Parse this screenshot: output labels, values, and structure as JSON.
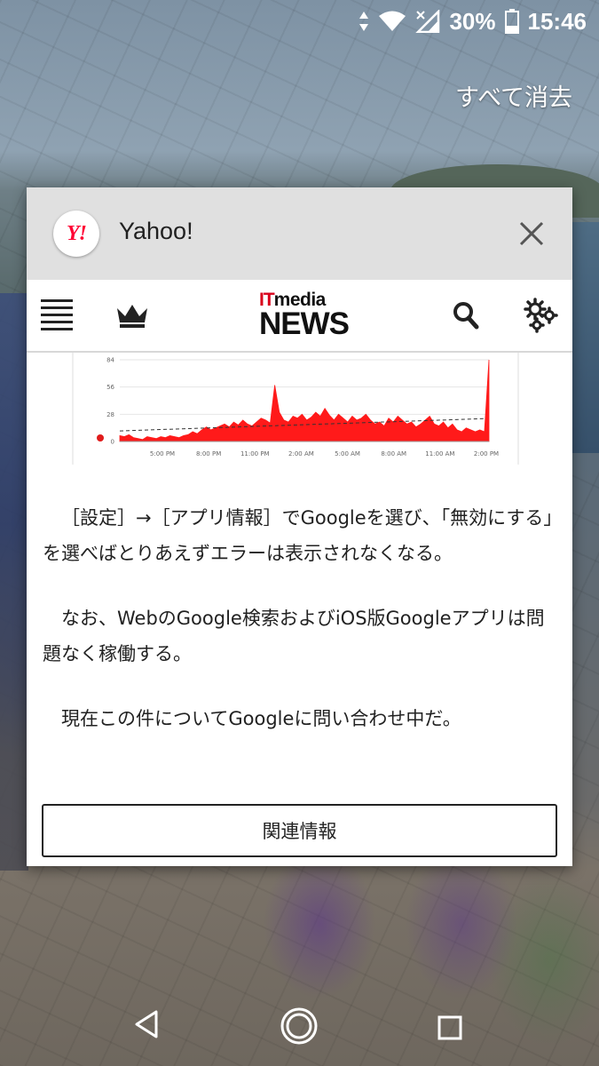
{
  "status_bar": {
    "battery_percent": "30%",
    "time": "15:46",
    "icons": [
      "data-transfer-icon",
      "wifi-icon",
      "cell-signal-no-service-icon",
      "battery-icon"
    ]
  },
  "recents": {
    "clear_all_label": "すべて消去"
  },
  "card": {
    "app_icon_text": "Y!",
    "app_name": "Yahoo!"
  },
  "site": {
    "logo_it": "IT",
    "logo_media": "media",
    "logo_news": "NEWS",
    "toolbar_icons": [
      "menu-icon",
      "crown-icon",
      "search-icon",
      "gear-icon"
    ]
  },
  "chart_data": {
    "type": "area",
    "title": "",
    "xlabel": "",
    "ylabel": "",
    "ylim": [
      0,
      84
    ],
    "y_ticks": [
      "0",
      "28",
      "56",
      "84"
    ],
    "x_ticks": [
      "5:00 PM",
      "8:00 PM",
      "11:00 PM",
      "2:00 AM",
      "5:00 AM",
      "8:00 AM",
      "11:00 AM",
      "2:00 PM"
    ],
    "series": [
      {
        "color": "#ff1a1a",
        "values": [
          6,
          5,
          7,
          4,
          3,
          2,
          5,
          4,
          3,
          5,
          4,
          6,
          5,
          4,
          6,
          7,
          10,
          8,
          12,
          15,
          12,
          14,
          16,
          18,
          15,
          20,
          17,
          22,
          18,
          16,
          20,
          24,
          22,
          19,
          58,
          30,
          22,
          20,
          26,
          24,
          28,
          22,
          25,
          30,
          26,
          34,
          27,
          22,
          28,
          24,
          20,
          26,
          22,
          24,
          28,
          22,
          18,
          20,
          16,
          24,
          20,
          26,
          22,
          18,
          20,
          15,
          18,
          22,
          26,
          18,
          16,
          20,
          14,
          18,
          12,
          10,
          14,
          12,
          10,
          12,
          10,
          84
        ]
      }
    ],
    "trend_line": true,
    "grid": true
  },
  "article": {
    "paragraphs": [
      "［設定］→［アプリ情報］でGoogleを選び、「無効にする」を選べばとりあえずエラーは表示されなくなる。",
      "なお、WebのGoogle検索およびiOS版Googleアプリは問題なく稼働する。",
      "現在この件についてGoogleに問い合わせ中だ。"
    ],
    "related_button_label": "関連情報"
  },
  "nav_bar": {
    "buttons": [
      "back-icon",
      "home-icon",
      "recents-icon"
    ]
  },
  "colors": {
    "yahoo_red": "#ff0033",
    "itmedia_red": "#d9001b",
    "chart_fill": "#ff1a1a",
    "card_header_bg": "#e0e0e0"
  }
}
